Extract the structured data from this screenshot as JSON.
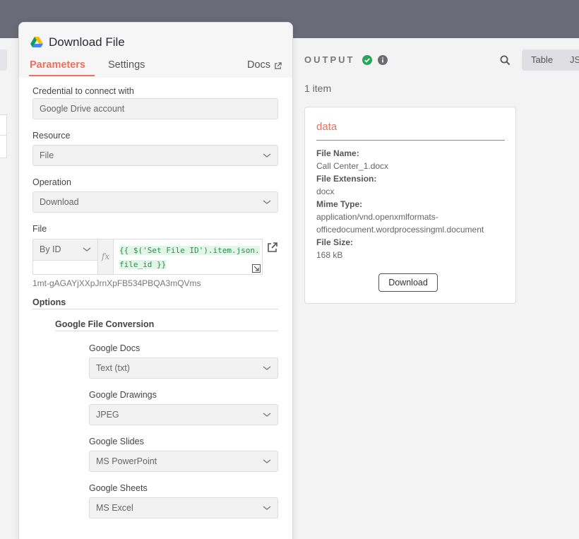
{
  "panel": {
    "title": "Download File",
    "tabs": {
      "parameters": "Parameters",
      "settings": "Settings",
      "docs": "Docs"
    }
  },
  "form": {
    "credential_label": "Credential to connect with",
    "credential_value": "Google Drive account",
    "resource_label": "Resource",
    "resource_value": "File",
    "operation_label": "Operation",
    "operation_value": "Download",
    "file_label": "File",
    "file_mode": "By ID",
    "fx": "fx",
    "expression_line1": "{{ $('Set File ID').item.json.",
    "expression_line2": "file_id }}",
    "file_id_preview": "1mt-gAGAYjXXpJrnXpFB534PBQA3mQVms",
    "options_label": "Options",
    "conversion_label": "Google File Conversion",
    "google_docs_label": "Google Docs",
    "google_docs_value": "Text (txt)",
    "google_drawings_label": "Google Drawings",
    "google_drawings_value": "JPEG",
    "google_slides_label": "Google Slides",
    "google_slides_value": "MS PowerPoint",
    "google_sheets_label": "Google Sheets",
    "google_sheets_value": "MS Excel"
  },
  "output": {
    "title": "OUTPUT",
    "view_table": "Table",
    "view_json": "JSON",
    "item_count": "1 item",
    "card": {
      "title": "data",
      "file_name_key": "File Name:",
      "file_name": "Call Center_1.docx",
      "file_extension_key": "File Extension:",
      "file_extension": "docx",
      "mime_type_key": "Mime Type:",
      "mime_type_1": "application/vnd.openxmlformats-",
      "mime_type_2": "officedocument.wordprocessingml.document",
      "file_size_key": "File Size:",
      "file_size": "168 kB",
      "download_label": "Download"
    }
  },
  "colors": {
    "accent": "#ef6f5a",
    "success": "#27a65a",
    "header_band": "#6b6a78"
  },
  "icons": [
    "google-drive-icon",
    "external-link-icon",
    "chevron-down-icon",
    "expand-icon",
    "check-circle-icon",
    "info-icon",
    "search-icon"
  ]
}
